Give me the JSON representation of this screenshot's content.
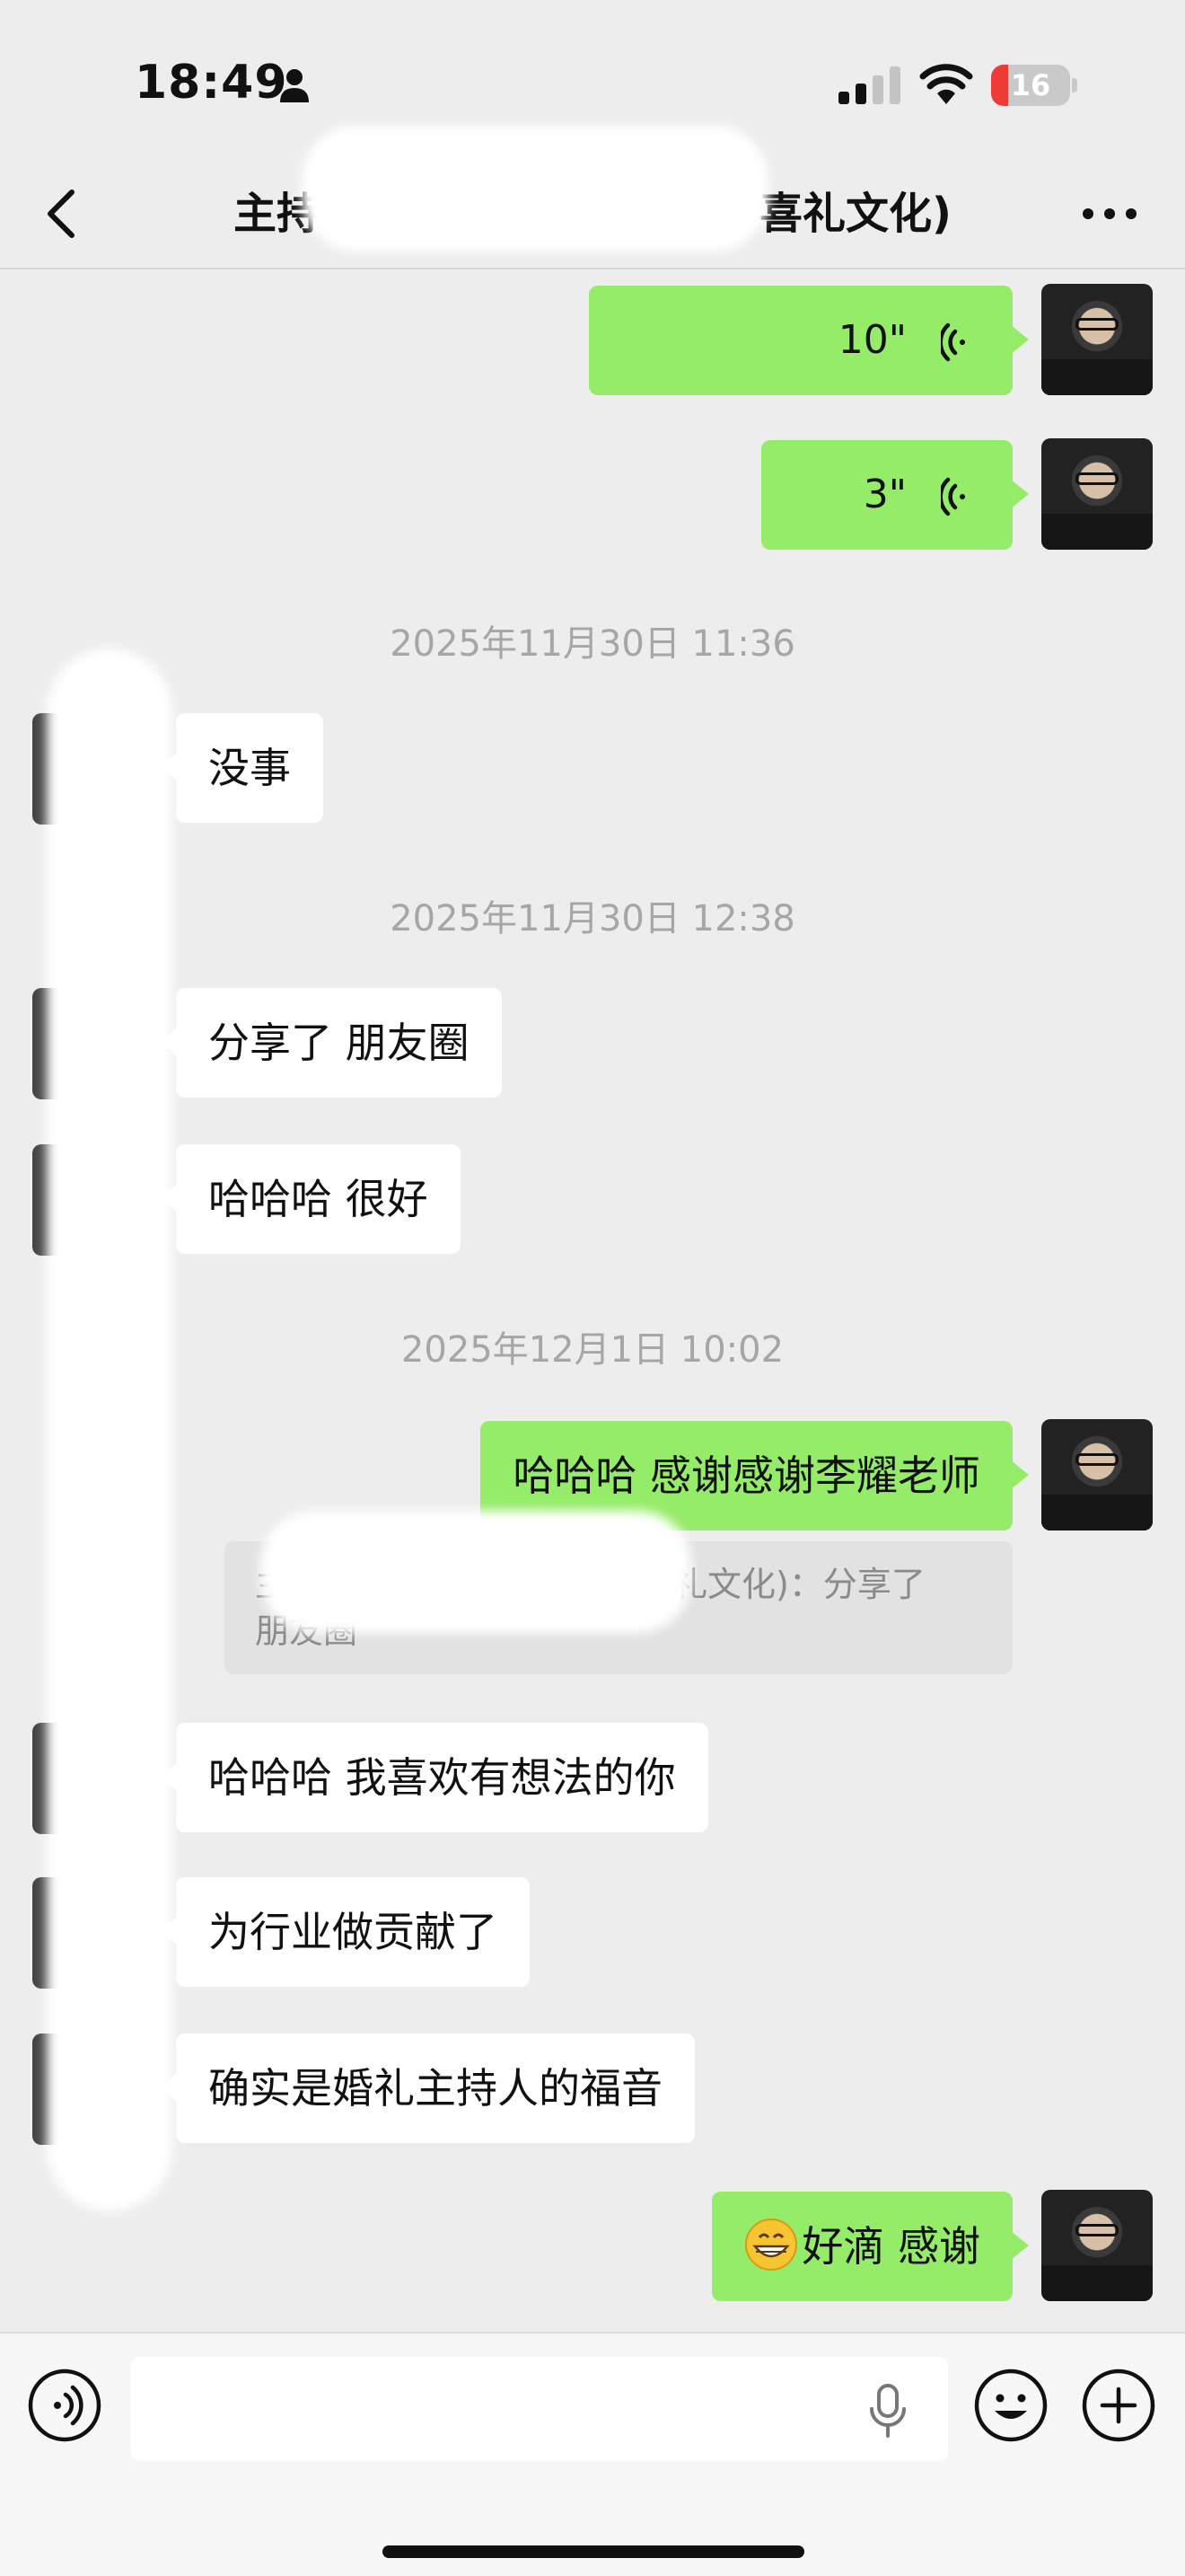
{
  "status_bar": {
    "time": "18:49",
    "battery_level": "16",
    "battery_fraction": 0.16,
    "battery_color": "#ee3b36"
  },
  "nav": {
    "title_prefix": "主持",
    "title_suffix": "喜礼文化)",
    "icons": [
      "chevron-left-icon",
      "more-dots-icon"
    ]
  },
  "colors": {
    "my_bubble": "#95ec69",
    "their_bubble": "#ffffff",
    "background": "#ededed"
  },
  "messages": {
    "voice_1": "10\"",
    "voice_2": "3\"",
    "ts_1": "2025年11月30日 11:36",
    "msg_1": "没事",
    "ts_2": "2025年11月30日 12:38",
    "msg_2": "分享了 朋友圈",
    "msg_3": "哈哈哈 很好",
    "ts_3": "2025年12月1日 10:02",
    "msg_4": "哈哈哈 感谢感谢李耀老师",
    "quote_line1_prefix": "主",
    "quote_line1_suffix": "礼文化)：分享了",
    "quote_line2": "朋友圈",
    "msg_5": "哈哈哈 我喜欢有想法的你",
    "msg_6": "为行业做贡献了",
    "msg_7": "确实是婚礼主持人的福音",
    "msg_8": "好滴 感谢"
  },
  "input_bar": {
    "placeholder": "",
    "icons": [
      "voice-toggle-icon",
      "mic-icon",
      "emoji-icon",
      "plus-icon"
    ]
  }
}
